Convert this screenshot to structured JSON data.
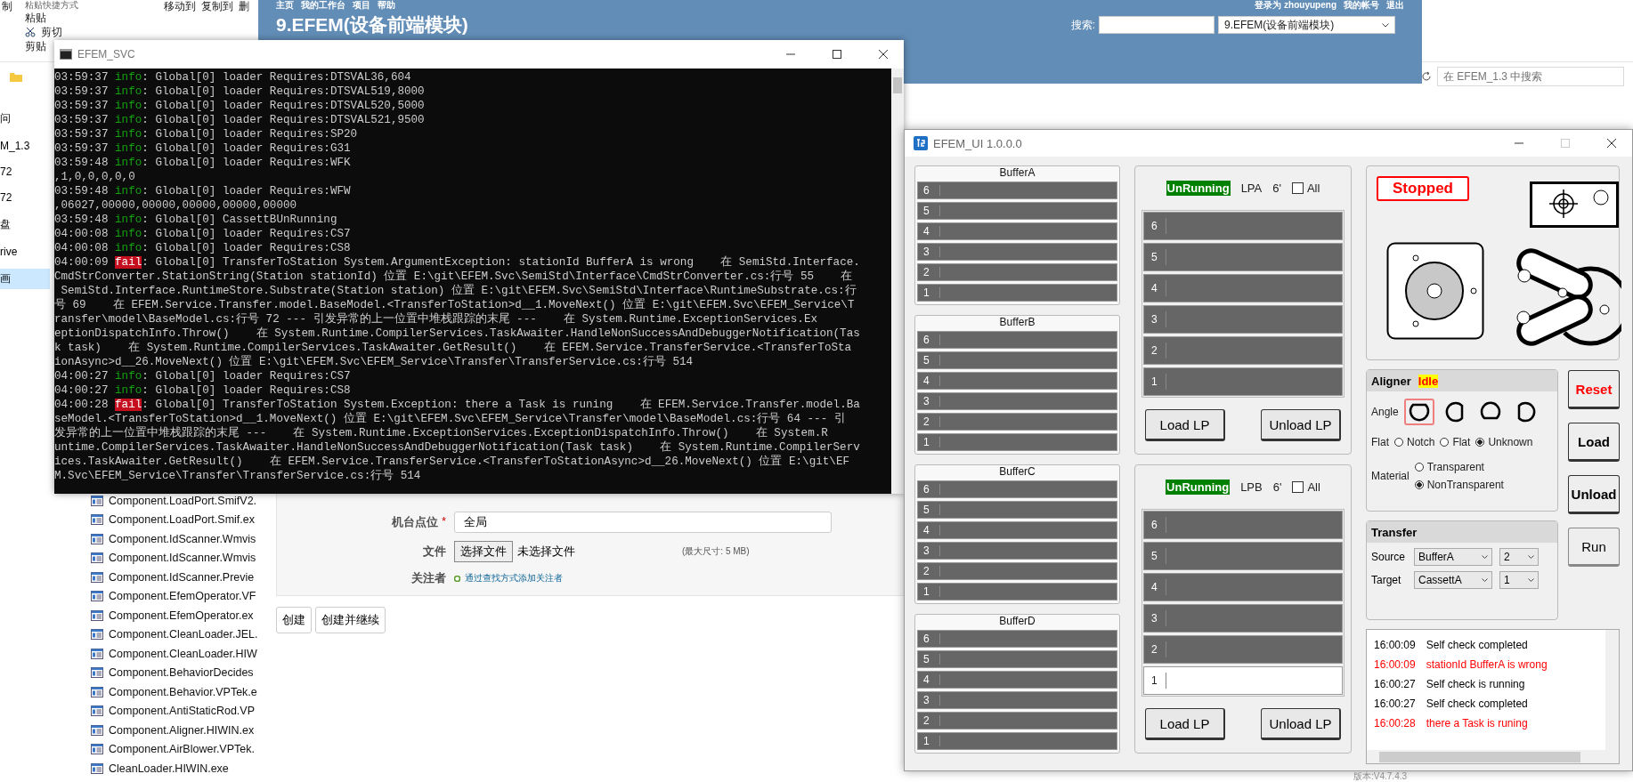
{
  "explorer": {
    "ribbon": {
      "cut_label": "制",
      "paste_shortcut": "粘贴快捷方式",
      "paste": "粘贴",
      "cut": "剪切",
      "clipboard": "剪贴",
      "move_to": "移动到",
      "copy_to": "复制到",
      "delete": "删"
    },
    "nav": [
      {
        "label": "问",
        "selected": false
      },
      {
        "label": "M_1.3",
        "selected": false
      },
      {
        "label": "72",
        "selected": false
      },
      {
        "label": "72",
        "selected": false
      },
      {
        "label": "盘",
        "selected": false
      },
      {
        "label": "rive",
        "selected": false
      },
      {
        "label": "画",
        "selected": true
      }
    ],
    "files": [
      "Component.LoadPort.SmifV2.",
      "Component.LoadPort.Smif.ex",
      "Component.IdScanner.Wmvis",
      "Component.IdScanner.Wmvis",
      "Component.IdScanner.Previe",
      "Component.EfemOperator.VF",
      "Component.EfemOperator.ex",
      "Component.CleanLoader.JEL.",
      "Component.CleanLoader.HIW",
      "Component.BehaviorDecides",
      "Component.Behavior.VPTek.e",
      "Component.AntiStaticRod.VP",
      "Component.Aligner.HIWIN.ex",
      "Component.AirBlower.VPTek.",
      "CleanLoader.HIWIN.exe"
    ],
    "search": {
      "placeholder": "在 EFEM_1.3 中搜索"
    },
    "version": "版本:V4.7.4.3"
  },
  "browser": {
    "top_links": [
      "主页",
      "我的工作台",
      "项目",
      "帮助"
    ],
    "user_links": [
      "登录为 zhouyupeng",
      "我的帐号",
      "退出"
    ],
    "project_title": "9.EFEM(设备前端模块)",
    "search_label": "搜索:",
    "project_select": "9.EFEM(设备前端模块)",
    "form": [
      {
        "kind": "text",
        "label": "机台点位",
        "required_mark": "*",
        "value": "全局"
      },
      {
        "kind": "file",
        "label": "文件",
        "button": "选择文件",
        "status": "未选择文件",
        "hint": "(最大尺寸: 5 MB)"
      },
      {
        "kind": "link",
        "label": "关注者",
        "link": "通过查找方式添加关注者"
      }
    ],
    "buttons": [
      "创建",
      "创建并继续"
    ]
  },
  "console": {
    "title": "EFEM_SVC",
    "lines": [
      {
        "time": "03:59:37",
        "level": "info",
        "message": ": Global[0] loader Requires:DTSVAL36,604"
      },
      {
        "time": "03:59:37",
        "level": "info",
        "message": ": Global[0] loader Requires:DTSVAL519,8000"
      },
      {
        "time": "03:59:37",
        "level": "info",
        "message": ": Global[0] loader Requires:DTSVAL520,5000"
      },
      {
        "time": "03:59:37",
        "level": "info",
        "message": ": Global[0] loader Requires:DTSVAL521,9500"
      },
      {
        "time": "03:59:37",
        "level": "info",
        "message": ": Global[0] loader Requires:SP20"
      },
      {
        "time": "03:59:37",
        "level": "info",
        "message": ": Global[0] loader Requires:G31"
      },
      {
        "time": "03:59:48",
        "level": "info",
        "message": ": Global[0] loader Requires:WFK"
      },
      {
        "text": ",1,0,0,0,0,0"
      },
      {
        "time": "03:59:48",
        "level": "info",
        "message": ": Global[0] loader Requires:WFW"
      },
      {
        "text": ",06027,00000,00000,00000,00000,00000"
      },
      {
        "time": "03:59:48",
        "level": "info",
        "message": ": Global[0] CassettBUnRunning"
      },
      {
        "time": "04:00:08",
        "level": "info",
        "message": ": Global[0] loader Requires:CS7"
      },
      {
        "time": "04:00:08",
        "level": "info",
        "message": ": Global[0] loader Requires:CS8"
      },
      {
        "time": "04:00:09",
        "level": "fail",
        "message": ": Global[0] TransferToStation System.ArgumentException: stationId BufferA is wrong    在 SemiStd.Interface."
      },
      {
        "text": "CmdStrConverter.StationString(Station stationId) 位置 E:\\git\\EFEM.Svc\\SemiStd\\Interface\\CmdStrConverter.cs:行号 55    在"
      },
      {
        "text": " SemiStd.Interface.RuntimeStore.Substrate(Station station) 位置 E:\\git\\EFEM.Svc\\SemiStd\\Interface\\RuntimeSubstrate.cs:行"
      },
      {
        "text": "号 69    在 EFEM.Service.Transfer.model.BaseModel.<TransferToStation>d__1.MoveNext() 位置 E:\\git\\EFEM.Svc\\EFEM_Service\\T"
      },
      {
        "text": "ransfer\\model\\BaseModel.cs:行号 72 --- 引发异常的上一位置中堆栈跟踪的末尾 ---    在 System.Runtime.ExceptionServices.Ex"
      },
      {
        "text": "eptionDispatchInfo.Throw()    在 System.Runtime.CompilerServices.TaskAwaiter.HandleNonSuccessAndDebuggerNotification(Tas"
      },
      {
        "text": "k task)    在 System.Runtime.CompilerServices.TaskAwaiter.GetResult()    在 EFEM.Service.TransferService.<TransferToSta"
      },
      {
        "text": "ionAsync>d__26.MoveNext() 位置 E:\\git\\EFEM.Svc\\EFEM_Service\\Transfer\\TransferService.cs:行号 514"
      },
      {
        "time": "04:00:27",
        "level": "info",
        "message": ": Global[0] loader Requires:CS7"
      },
      {
        "time": "04:00:27",
        "level": "info",
        "message": ": Global[0] loader Requires:CS8"
      },
      {
        "time": "04:00:28",
        "level": "fail",
        "message": ": Global[0] TransferToStation System.Exception: there a Task is runing    在 EFEM.Service.Transfer.model.Ba"
      },
      {
        "text": "seModel.<TransferToStation>d__1.MoveNext() 位置 E:\\git\\EFEM.Svc\\EFEM_Service\\Transfer\\model\\BaseModel.cs:行号 64 --- 引"
      },
      {
        "text": "发异常的上一位置中堆栈跟踪的末尾 ---    在 System.Runtime.ExceptionServices.ExceptionDispatchInfo.Throw()    在 System.R"
      },
      {
        "text": "untime.CompilerServices.TaskAwaiter.HandleNonSuccessAndDebuggerNotification(Task task)    在 System.Runtime.CompilerServ"
      },
      {
        "text": "ices.TaskAwaiter.GetResult()    在 EFEM.Service.TransferService.<TransferToStationAsync>d__26.MoveNext() 位置 E:\\git\\EF"
      },
      {
        "text": "M.Svc\\EFEM_Service\\Transfer\\TransferService.cs:行号 514"
      }
    ]
  },
  "efem_ui": {
    "title": "EFEM_UI 1.0.0.0",
    "buffers": [
      {
        "name": "BufferA",
        "slots": [
          {
            "label": "6",
            "present": false
          },
          {
            "label": "5",
            "present": false
          },
          {
            "label": "4",
            "present": false
          },
          {
            "label": "3",
            "present": false
          },
          {
            "label": "2",
            "present": false
          },
          {
            "label": "1",
            "present": false
          }
        ]
      },
      {
        "name": "BufferB",
        "slots": [
          {
            "label": "6",
            "present": false
          },
          {
            "label": "5",
            "present": false
          },
          {
            "label": "4",
            "present": false
          },
          {
            "label": "3",
            "present": false
          },
          {
            "label": "2",
            "present": false
          },
          {
            "label": "1",
            "present": false
          }
        ]
      },
      {
        "name": "BufferC",
        "slots": [
          {
            "label": "6",
            "present": false
          },
          {
            "label": "5",
            "present": false
          },
          {
            "label": "4",
            "present": false
          },
          {
            "label": "3",
            "present": false
          },
          {
            "label": "2",
            "present": false
          },
          {
            "label": "1",
            "present": false
          }
        ]
      },
      {
        "name": "BufferD",
        "slots": [
          {
            "label": "6",
            "present": false
          },
          {
            "label": "5",
            "present": false
          },
          {
            "label": "4",
            "present": false
          },
          {
            "label": "3",
            "present": false
          },
          {
            "label": "2",
            "present": false
          },
          {
            "label": "1",
            "present": false
          }
        ]
      }
    ],
    "load_ports": [
      {
        "status": "UnRunning",
        "name": "LPA",
        "size": "6'",
        "all_label": "All",
        "all_checked": false,
        "slots": [
          {
            "label": "6",
            "present": false
          },
          {
            "label": "5",
            "present": false
          },
          {
            "label": "4",
            "present": false
          },
          {
            "label": "3",
            "present": false
          },
          {
            "label": "2",
            "present": false
          },
          {
            "label": "1",
            "present": false
          }
        ],
        "buttons": [
          "Load LP",
          "Unload LP"
        ]
      },
      {
        "status": "UnRunning",
        "name": "LPB",
        "size": "6'",
        "all_label": "All",
        "all_checked": false,
        "slots": [
          {
            "label": "6",
            "present": false
          },
          {
            "label": "5",
            "present": false
          },
          {
            "label": "4",
            "present": false
          },
          {
            "label": "3",
            "present": false
          },
          {
            "label": "2",
            "present": false
          },
          {
            "label": "1",
            "present": true
          }
        ],
        "buttons": [
          "Load LP",
          "Unload LP"
        ]
      }
    ],
    "system_status": "Stopped",
    "aligner": {
      "title": "Aligner",
      "status": "Idle",
      "angle_label": "Angle",
      "angles": [
        {
          "kind": "flat-top",
          "selected": true
        },
        {
          "kind": "flat-right",
          "selected": false
        },
        {
          "kind": "flat-bottom",
          "selected": false
        },
        {
          "kind": "flat-left",
          "selected": false
        }
      ],
      "flat_label": "Flat",
      "flat_options": [
        {
          "label": "Notch",
          "selected": false
        },
        {
          "label": "Flat",
          "selected": false
        },
        {
          "label": "Unknown",
          "selected": true
        }
      ],
      "material_label": "Material",
      "material_options": [
        {
          "label": "Transparent",
          "selected": false
        },
        {
          "label": "NonTransparent",
          "selected": true
        }
      ]
    },
    "actions": [
      {
        "label": "Reset",
        "kind": "danger"
      },
      {
        "label": "Load",
        "kind": "normal"
      },
      {
        "label": "Unload",
        "kind": "normal"
      },
      {
        "label": "Run",
        "kind": "plain"
      }
    ],
    "transfer": {
      "title": "Transfer",
      "rows": [
        {
          "label": "Source",
          "station": "BufferA",
          "slot": "2"
        },
        {
          "label": "Target",
          "station": "CassettA",
          "slot": "1"
        }
      ]
    },
    "log": [
      {
        "time": "16:00:09",
        "message": "Self check completed",
        "error": false
      },
      {
        "time": "16:00:09",
        "message": "stationId BufferA is wrong",
        "error": true
      },
      {
        "time": "16:00:27",
        "message": "Self check is running",
        "error": false
      },
      {
        "time": "16:00:27",
        "message": "Self check completed",
        "error": false
      },
      {
        "time": "16:00:28",
        "message": "there a Task is runing",
        "error": true
      }
    ]
  }
}
